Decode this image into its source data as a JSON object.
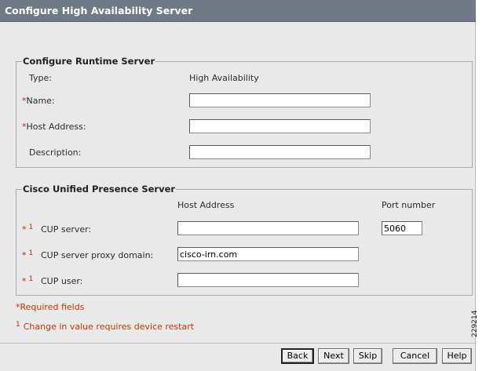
{
  "window": {
    "title": "Configure High Availability Server"
  },
  "runtime": {
    "legend": "Configure Runtime Server",
    "type_label": "Type:",
    "type_value": "High Availability",
    "name_label": "Name:",
    "name_value": "",
    "host_label": "Host Address:",
    "host_value": "",
    "desc_label": "Description:",
    "desc_value": ""
  },
  "cup": {
    "legend": "Cisco Unified Presence Server",
    "col_host": "Host Address",
    "col_port": "Port number",
    "server_label": "CUP server:",
    "server_value": "",
    "port_value": "5060",
    "proxy_label": "CUP server proxy domain:",
    "proxy_value": "cisco-irn.com",
    "user_label": "CUP user:",
    "user_value": ""
  },
  "markers": {
    "required": "*",
    "restart": "1"
  },
  "notes": {
    "required": "Required fields",
    "restart": "Change in value requires device restart"
  },
  "buttons": {
    "back": "Back",
    "next": "Next",
    "skip": "Skip",
    "cancel": "Cancel",
    "help": "Help"
  },
  "figure_id": "229214",
  "colors": {
    "titlebar": "#6f7a86",
    "panel": "#e9e9e9",
    "required_red": "#cc2200"
  }
}
